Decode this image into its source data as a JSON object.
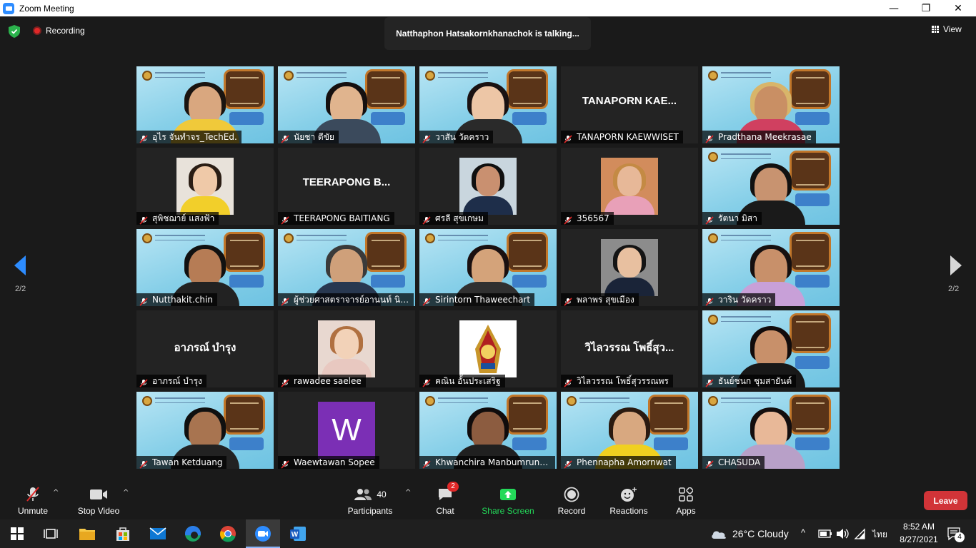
{
  "window": {
    "title": "Zoom Meeting",
    "minimize": "—",
    "maximize": "❐",
    "close": "✕"
  },
  "top_bar": {
    "recording_label": "Recording",
    "talking_banner": "Natthaphon Hatsakornkhanachok is talking...",
    "view_label": "View"
  },
  "pagination": {
    "left_page": "2/2",
    "right_page": "2/2"
  },
  "tiles": [
    {
      "name": "อุไร จันทำจร_TechEd.",
      "style": "video",
      "skin": "#d9a77f",
      "hair": "#1a1410",
      "shirt": "#f0c93a"
    },
    {
      "name": "นัยชา ดีขัย",
      "style": "video",
      "skin": "#e0b48e",
      "hair": "#151010",
      "shirt": "#3b4a5c"
    },
    {
      "name": "วาสัน วัดคราว",
      "style": "video",
      "skin": "#edc6a6",
      "hair": "#1a1212",
      "shirt": "#2a2a2a"
    },
    {
      "name": "TANAPORN KAEWWISET",
      "style": "text",
      "display": "TANAPORN KAE..."
    },
    {
      "name": "Pradthana Meekrasae",
      "style": "video",
      "skin": "#c98f64",
      "hair": "#d8b56a",
      "shirt": "#d04060"
    },
    {
      "name": "สุพิชฌาย์ แสงฟ้า",
      "style": "photo",
      "photo_bg": "#e8e2da",
      "skin": "#efc9a8",
      "hair": "#2a1d14",
      "shirt": "#f2cf2a"
    },
    {
      "name": "TEERAPONG  BAITIANG",
      "style": "text",
      "display": "TEERAPONG  B..."
    },
    {
      "name": "ศรลี สุขเกษม",
      "style": "photo",
      "photo_bg": "#c9d6de",
      "skin": "#c99070",
      "hair": "#101010",
      "shirt": "#1e2e4a"
    },
    {
      "name": "356567",
      "style": "photo",
      "photo_bg": "#d28c5c",
      "skin": "#e7b898",
      "hair": "#c48a44",
      "shirt": "#e8a0b8"
    },
    {
      "name": "รัตนา มิสา",
      "style": "video",
      "skin": "#c89370",
      "hair": "#111",
      "shirt": "#1a1a1a"
    },
    {
      "name": "Nutthakit.chin",
      "style": "video",
      "skin": "#b67c55",
      "hair": "#111",
      "shirt": "#222"
    },
    {
      "name": "ผู้ช่วยศาสตราจารย์อานนท์ นิยมพันธ์",
      "style": "video",
      "skin": "#cfa07a",
      "hair": "#3a3a3a",
      "shirt": "#283850"
    },
    {
      "name": "Sirintorn Thaweechart",
      "style": "video",
      "skin": "#d4a37a",
      "hair": "#1a1010",
      "shirt": "#303030"
    },
    {
      "name": "พลาพร สุขเมือง",
      "style": "photo",
      "photo_bg": "#8c8c8c",
      "skin": "#e8c0a0",
      "hair": "#141414",
      "shirt": "#1a2438"
    },
    {
      "name": "วาริน วัดคราว",
      "style": "video",
      "skin": "#c8906a",
      "hair": "#161010",
      "shirt": "#c8a0d8"
    },
    {
      "name": "อาภรณ์  บำรุง",
      "style": "text",
      "display": "อาภรณ์  บำรุง"
    },
    {
      "name": "rawadee saelee",
      "style": "photo",
      "photo_bg": "#e8d8d0",
      "skin": "#f2d2b8",
      "hair": "#b07040",
      "shirt": "#e8c8c0"
    },
    {
      "name": "คณิน อั้นประเสริฐ",
      "style": "emblem"
    },
    {
      "name": "วิไลวรรณ โพธิ์สุวรรณพร",
      "style": "text",
      "display": "วิไลวรรณ โพธิ์สุว..."
    },
    {
      "name": "ธันย์ชนก ชุมสายันต์",
      "style": "video",
      "skin": "#c8906a",
      "hair": "#120c0c",
      "shirt": "#181818"
    },
    {
      "name": "Tawan Ketduang",
      "style": "video",
      "skin": "#a87450",
      "hair": "#101010",
      "shirt": "#222"
    },
    {
      "name": "Waewtawan Sopee",
      "style": "letter",
      "letter": "W",
      "letter_bg": "#7b2fb5"
    },
    {
      "name": "Khwanchira Manbumrungsat",
      "style": "video",
      "skin": "#8c5c40",
      "hair": "#100c0c",
      "shirt": "#202020"
    },
    {
      "name": "Phennapha Amornwat",
      "style": "video",
      "skin": "#d8a880",
      "hair": "#2a1a10",
      "shirt": "#f0d020"
    },
    {
      "name": "CHASUDA",
      "style": "video",
      "skin": "#e8b898",
      "hair": "#140e0e",
      "shirt": "#b8a0c8"
    }
  ],
  "toolbar": {
    "unmute": "Unmute",
    "stop_video": "Stop Video",
    "participants": "Participants",
    "participants_count": "40",
    "chat": "Chat",
    "chat_badge": "2",
    "share_screen": "Share Screen",
    "record": "Record",
    "reactions": "Reactions",
    "apps": "Apps",
    "leave": "Leave",
    "caret": "^"
  },
  "taskbar": {
    "weather": "26°C  Cloudy",
    "language": "ไทย",
    "time": "8:52 AM",
    "date": "8/27/2021",
    "notifications": "4"
  },
  "colors": {
    "accent": "#2d8cff",
    "record_red": "#e02828",
    "leave_red": "#d13438",
    "share_green": "#23d959",
    "muted_mic": "#e02828"
  }
}
